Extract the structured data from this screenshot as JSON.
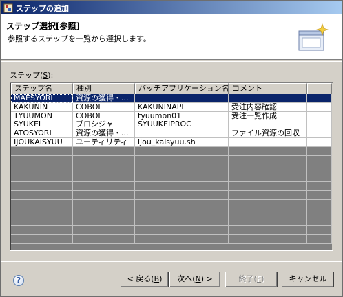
{
  "window": {
    "title": "ステップの追加"
  },
  "header": {
    "title": "ステップ選択[参照]",
    "description": "参照するステップを一覧から選択します。"
  },
  "steps": {
    "label": "ステップ(",
    "mnemonic": "S",
    "label_suffix": "):",
    "columns": [
      "ステップ名",
      "種別",
      "バッチアプリケーション名",
      "コメント",
      ""
    ],
    "rows": [
      [
        "MAESYORI",
        "資源の獲得・...",
        "",
        "",
        ""
      ],
      [
        "KAKUNIN",
        "COBOL",
        "KAKUNINAPL",
        "受注内容確認",
        ""
      ],
      [
        "TYUUMON",
        "COBOL",
        "tyuumon01",
        "受注一覧作成",
        ""
      ],
      [
        "SYUKEI",
        "プロシジャ",
        "SYUUKEIPROC",
        "",
        ""
      ],
      [
        "ATOSYORI",
        "資源の獲得・...",
        "",
        "ファイル資源の回収",
        ""
      ],
      [
        "IJOUKAISYUU",
        "ユーティリティ",
        "ijou_kaisyuu.sh",
        "",
        ""
      ]
    ],
    "selected_row": 0
  },
  "buttons": {
    "back": {
      "label": "< 戻る(",
      "mnemonic": "B",
      "suffix": ")"
    },
    "next": {
      "label": "次へ(",
      "mnemonic": "N",
      "suffix": ") >"
    },
    "finish": {
      "label": "終了(",
      "mnemonic": "F",
      "suffix": ")"
    },
    "cancel": {
      "label": "キャンセル"
    }
  },
  "help": {
    "glyph": "?"
  }
}
